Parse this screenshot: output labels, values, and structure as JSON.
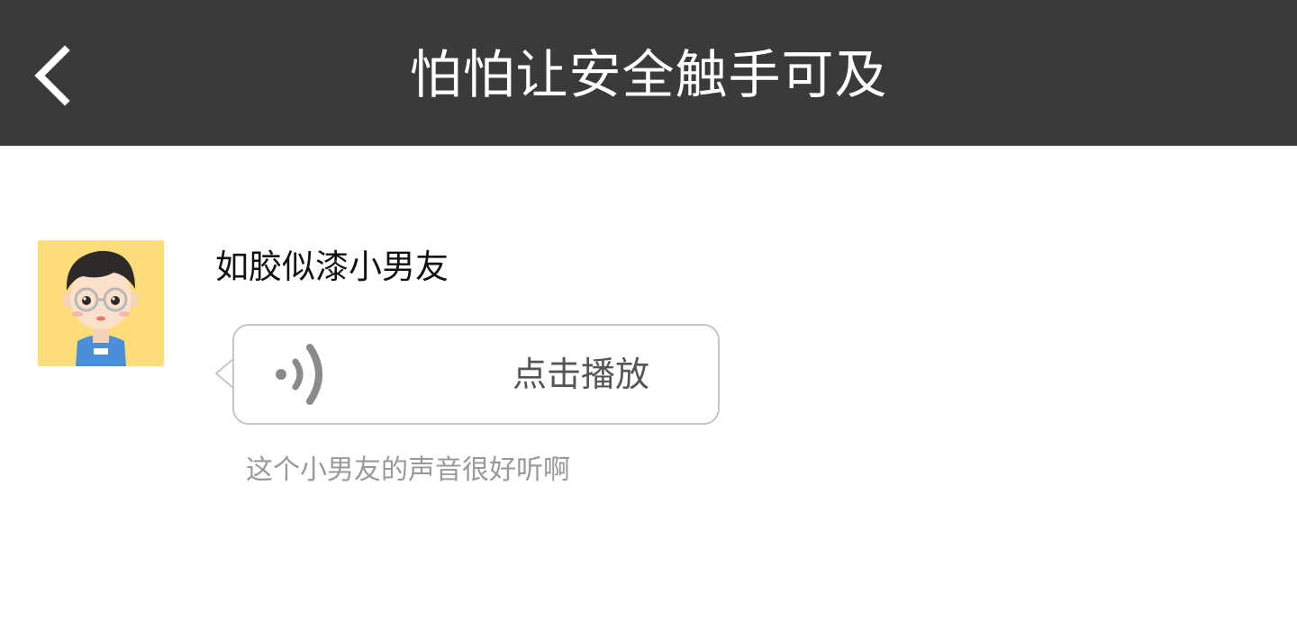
{
  "header": {
    "title": "怕怕让安全触手可及",
    "back_icon": "chevron-left-icon",
    "background_color": "#3a3a3a"
  },
  "post": {
    "avatar_icon": "cartoon-boy-avatar",
    "username": "如胶似漆小男友",
    "voice_bubble": {
      "sound_icon": "sound-wave-icon",
      "label": "点击播放"
    },
    "caption": "这个小男友的声音很好听啊"
  }
}
